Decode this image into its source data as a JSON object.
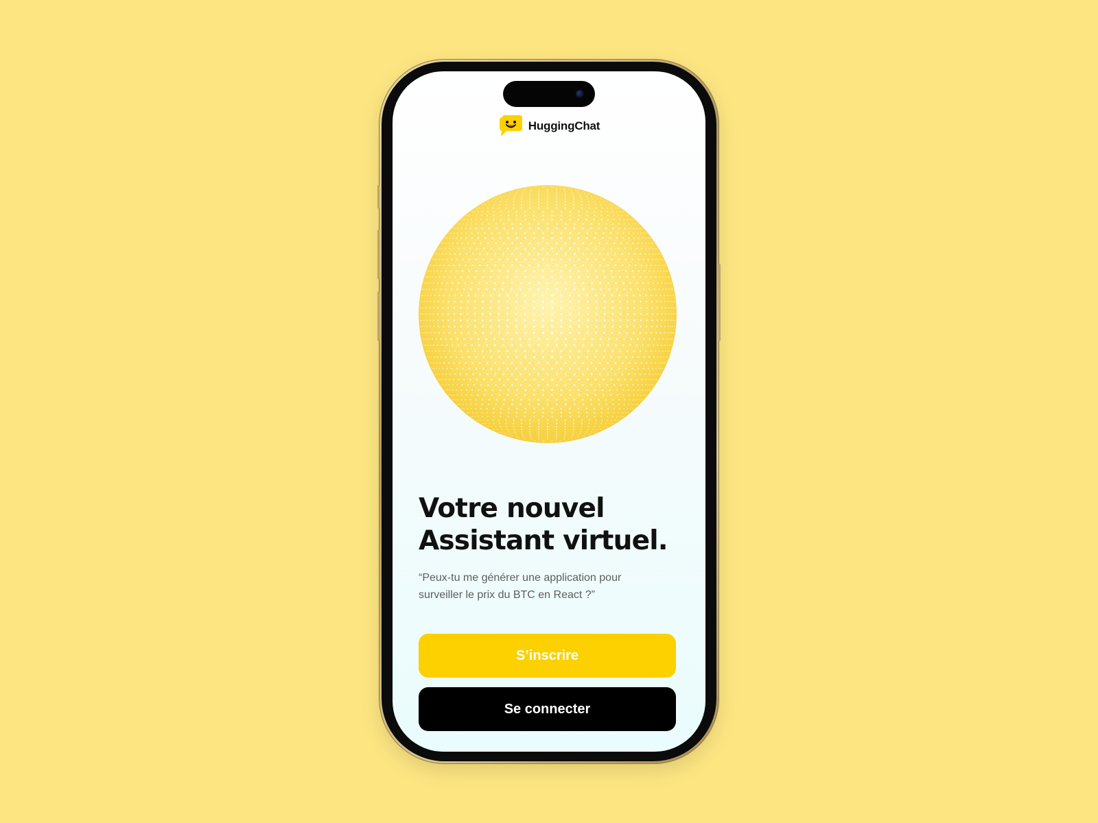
{
  "background_color": "#fde682",
  "brand": {
    "name": "HuggingChat",
    "logo_icon": "hugging-face-chat-bubble-icon",
    "logo_color": "#fdd000"
  },
  "hero": {
    "visual": "dotted-globe",
    "globe_color": "#fad94a"
  },
  "headline": {
    "line1": "Votre nouvel",
    "line2": "Assistant virtuel."
  },
  "subtitle": {
    "line1": "“Peux-tu me générer une application pour",
    "line2": "surveiller le prix du BTC en React ?”"
  },
  "buttons": {
    "signup_label": "S’inscrire",
    "signup_color": "#fdd000",
    "login_label": "Se connecter",
    "login_color": "#000000"
  }
}
